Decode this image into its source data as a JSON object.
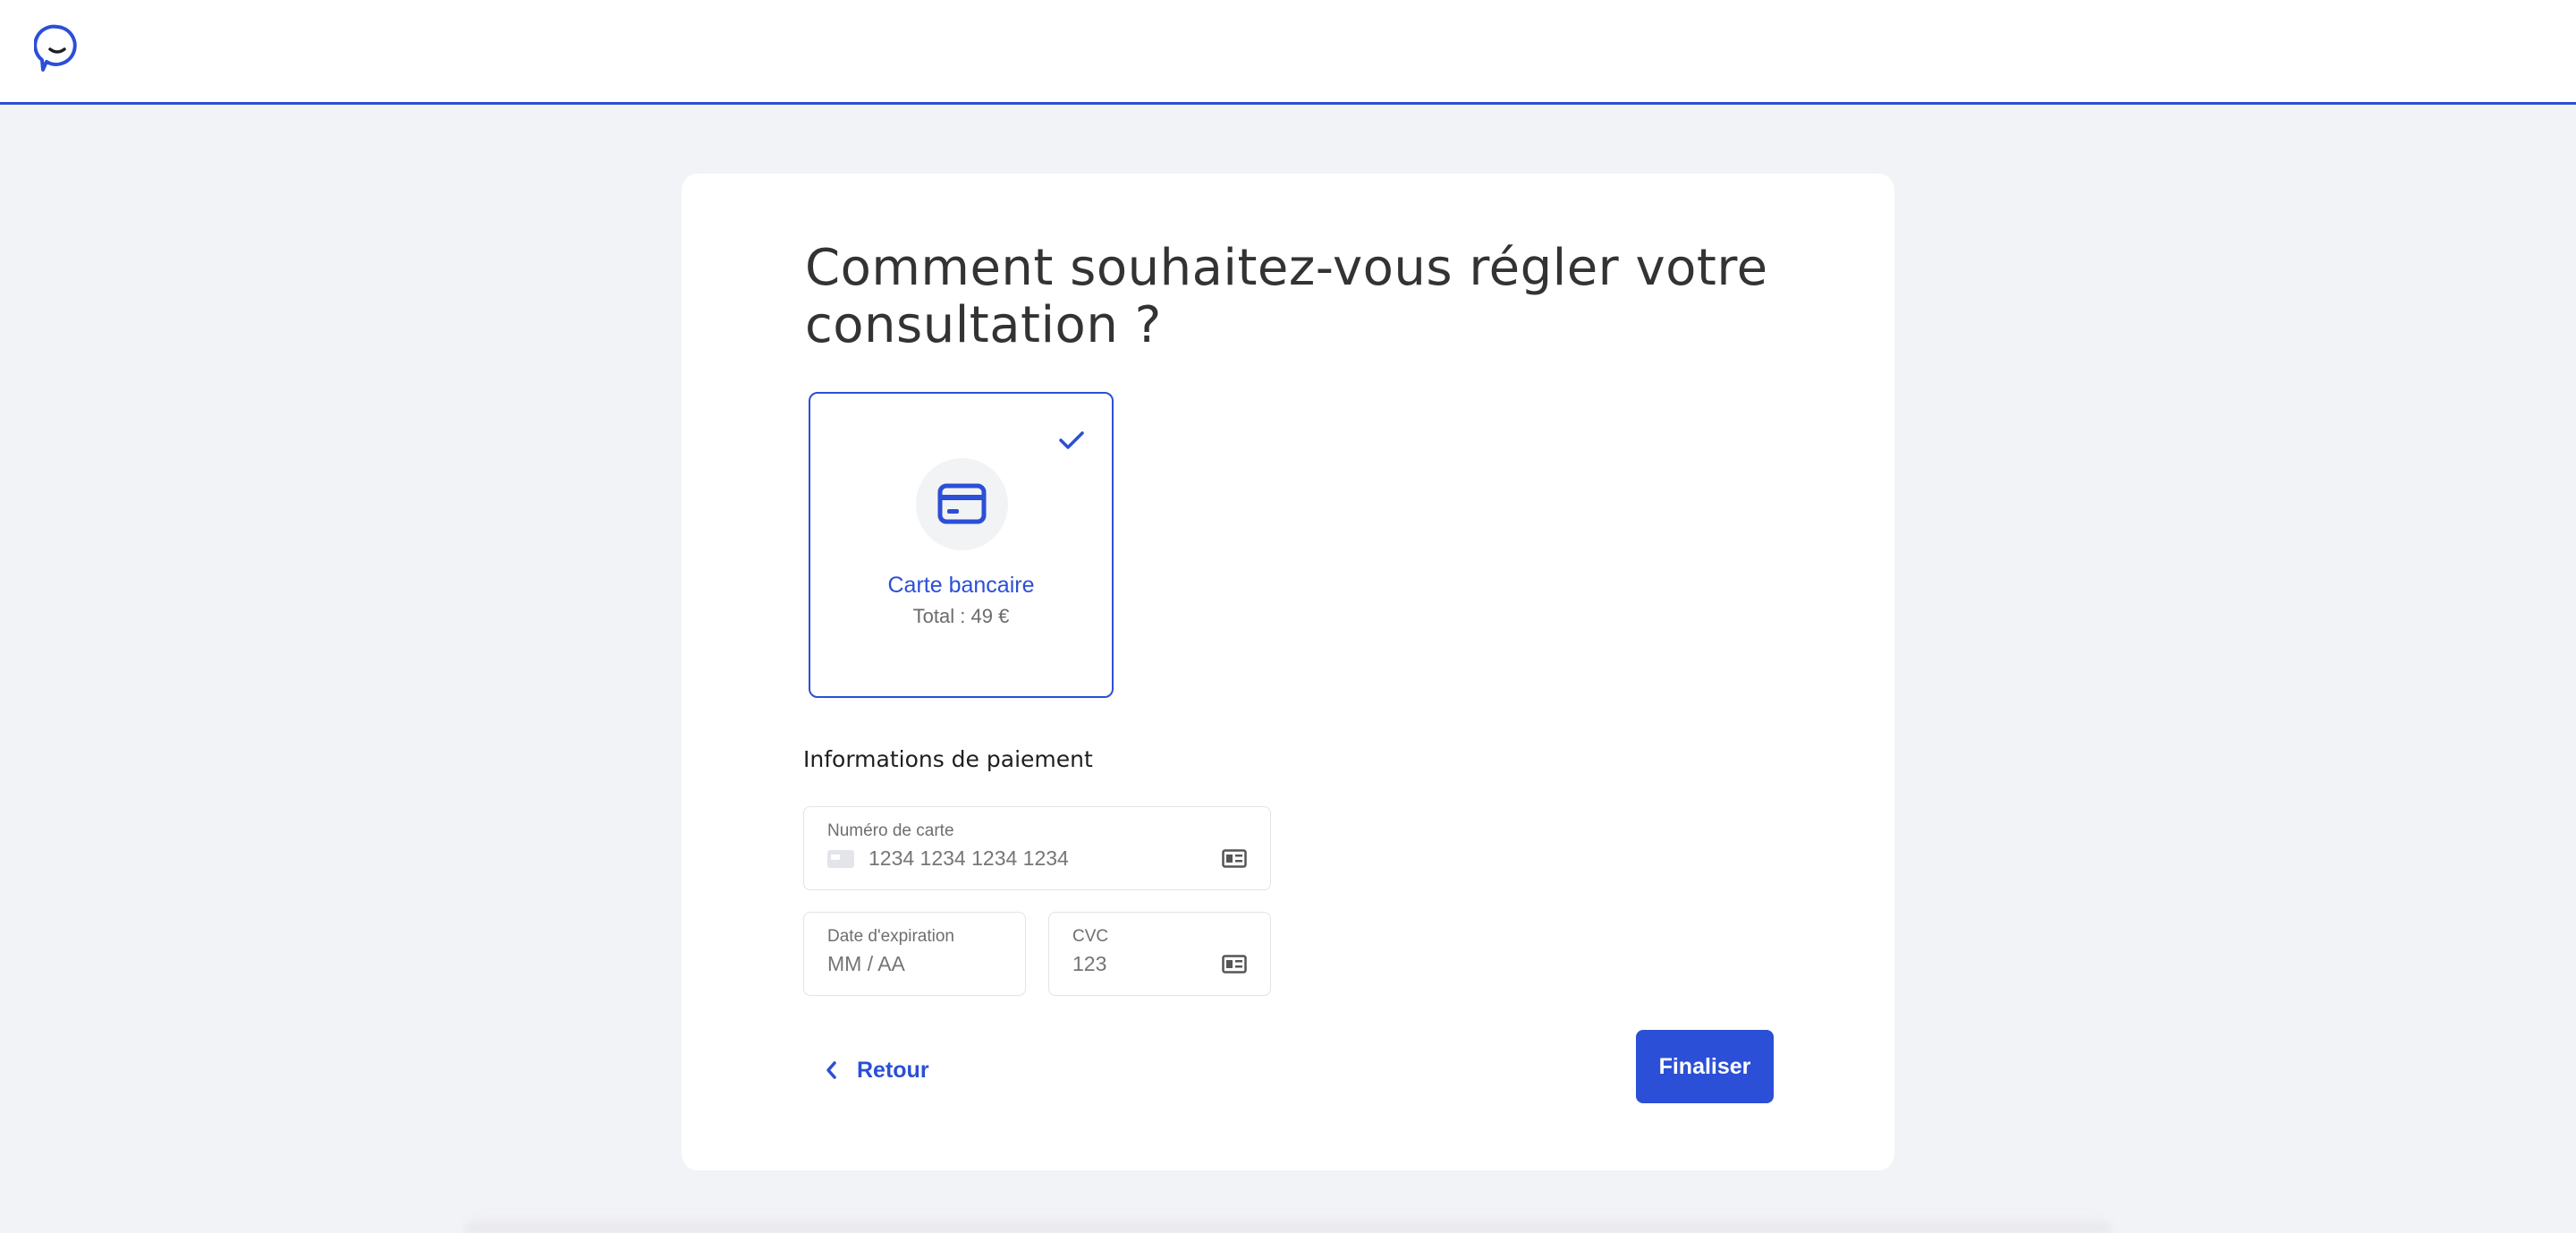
{
  "header": {
    "logo_icon": "smiling-chat-bubble-icon"
  },
  "colors": {
    "accent": "#2b4fd6",
    "background": "#f2f3f7",
    "card": "#ffffff"
  },
  "page": {
    "title": "Comment souhaitez-vous régler votre consultation ?"
  },
  "payment_method": {
    "label": "Carte bancaire",
    "total": "Total : 49 €",
    "selected": true,
    "icon": "credit-card-icon",
    "check_icon": "checkmark-icon"
  },
  "payment_info": {
    "section_title": "Informations de paiement",
    "card_number": {
      "label": "Numéro de carte",
      "placeholder": "1234 1234 1234 1234"
    },
    "expiry": {
      "label": "Date d'expiration",
      "placeholder": "MM / AA"
    },
    "cvc": {
      "label": "CVC",
      "placeholder": "123"
    }
  },
  "actions": {
    "back_label": "Retour",
    "finalize_label": "Finaliser"
  }
}
